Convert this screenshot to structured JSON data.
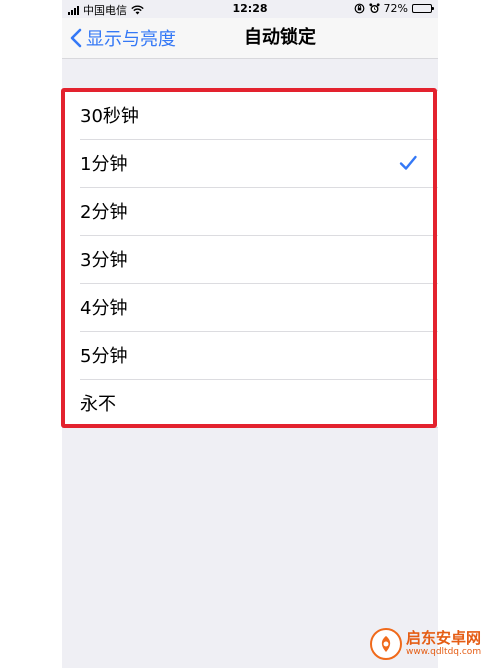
{
  "status_bar": {
    "carrier": "中国电信",
    "time": "12:28",
    "battery_percent": "72%",
    "battery_level": 0.72,
    "icons": [
      "signal-icon",
      "wifi-icon",
      "rotation-lock-icon",
      "alarm-icon",
      "battery-icon"
    ]
  },
  "nav": {
    "back_label": "显示与亮度",
    "title": "自动锁定"
  },
  "options": {
    "items": [
      {
        "label": "30秒钟",
        "selected": false
      },
      {
        "label": "1分钟",
        "selected": true
      },
      {
        "label": "2分钟",
        "selected": false
      },
      {
        "label": "3分钟",
        "selected": false
      },
      {
        "label": "4分钟",
        "selected": false
      },
      {
        "label": "5分钟",
        "selected": false
      },
      {
        "label": "永不",
        "selected": false
      }
    ]
  },
  "watermark": {
    "name": "启东安卓网",
    "url": "www.qdltdq.com"
  },
  "colors": {
    "accent": "#3478f6",
    "highlight": "#e3222e",
    "background": "#efeff4"
  }
}
